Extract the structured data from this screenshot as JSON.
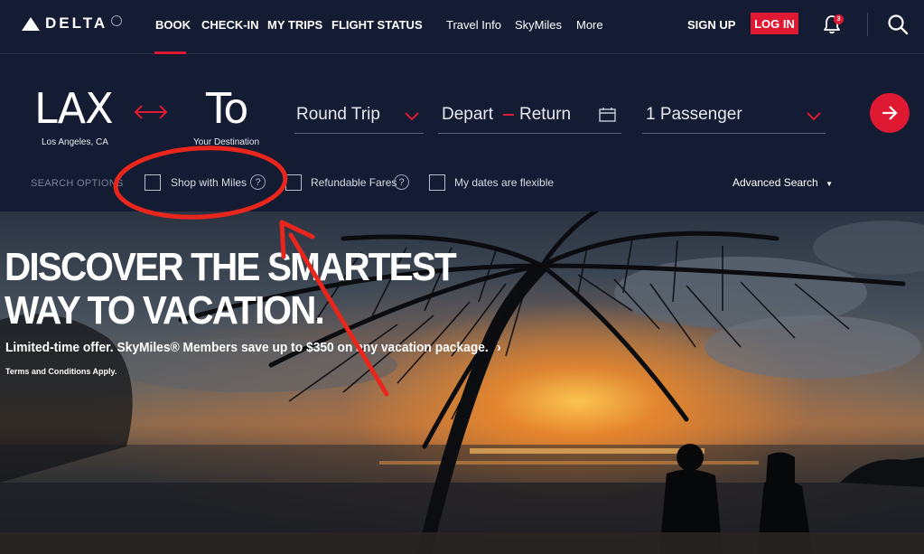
{
  "nav": {
    "logo_text": "DELTA",
    "items": [
      {
        "label": "BOOK"
      },
      {
        "label": "CHECK-IN"
      },
      {
        "label": "MY TRIPS"
      },
      {
        "label": "FLIGHT STATUS"
      },
      {
        "label": "Travel Info"
      },
      {
        "label": "SkyMiles"
      },
      {
        "label": "More"
      }
    ],
    "active_item": "BOOK",
    "sign_up": "SIGN UP",
    "log_in": "LOG IN",
    "notification_count": "3",
    "icons": {
      "bell": "bell-icon",
      "search": "search-icon"
    }
  },
  "booking": {
    "from_code": "LAX",
    "from_city": "Los Angeles, CA",
    "to_code": "To",
    "to_label": "Your Destination",
    "trip_type": "Round Trip",
    "depart": "Depart",
    "return": "Return",
    "passengers": "1 Passenger",
    "search_options_label": "SEARCH OPTIONS",
    "options": [
      {
        "label": "Shop with Miles",
        "checked": false,
        "help": "?"
      },
      {
        "label": "Refundable Fares",
        "checked": false,
        "help": "?"
      },
      {
        "label": "My dates are flexible",
        "checked": false
      }
    ],
    "advanced_search": "Advanced Search"
  },
  "hero": {
    "headline_line1": "DISCOVER THE SMARTEST",
    "headline_line2": "WAY TO VACATION.",
    "offer": "Limited-time offer. SkyMiles® Members save up to $350 on any vacation package.",
    "offer_chevron": "›",
    "terms": "Terms and Conditions Apply."
  },
  "colors": {
    "brand_red": "#e01933",
    "nav_bg": "#141c33",
    "annotation_red": "#e8261c"
  }
}
